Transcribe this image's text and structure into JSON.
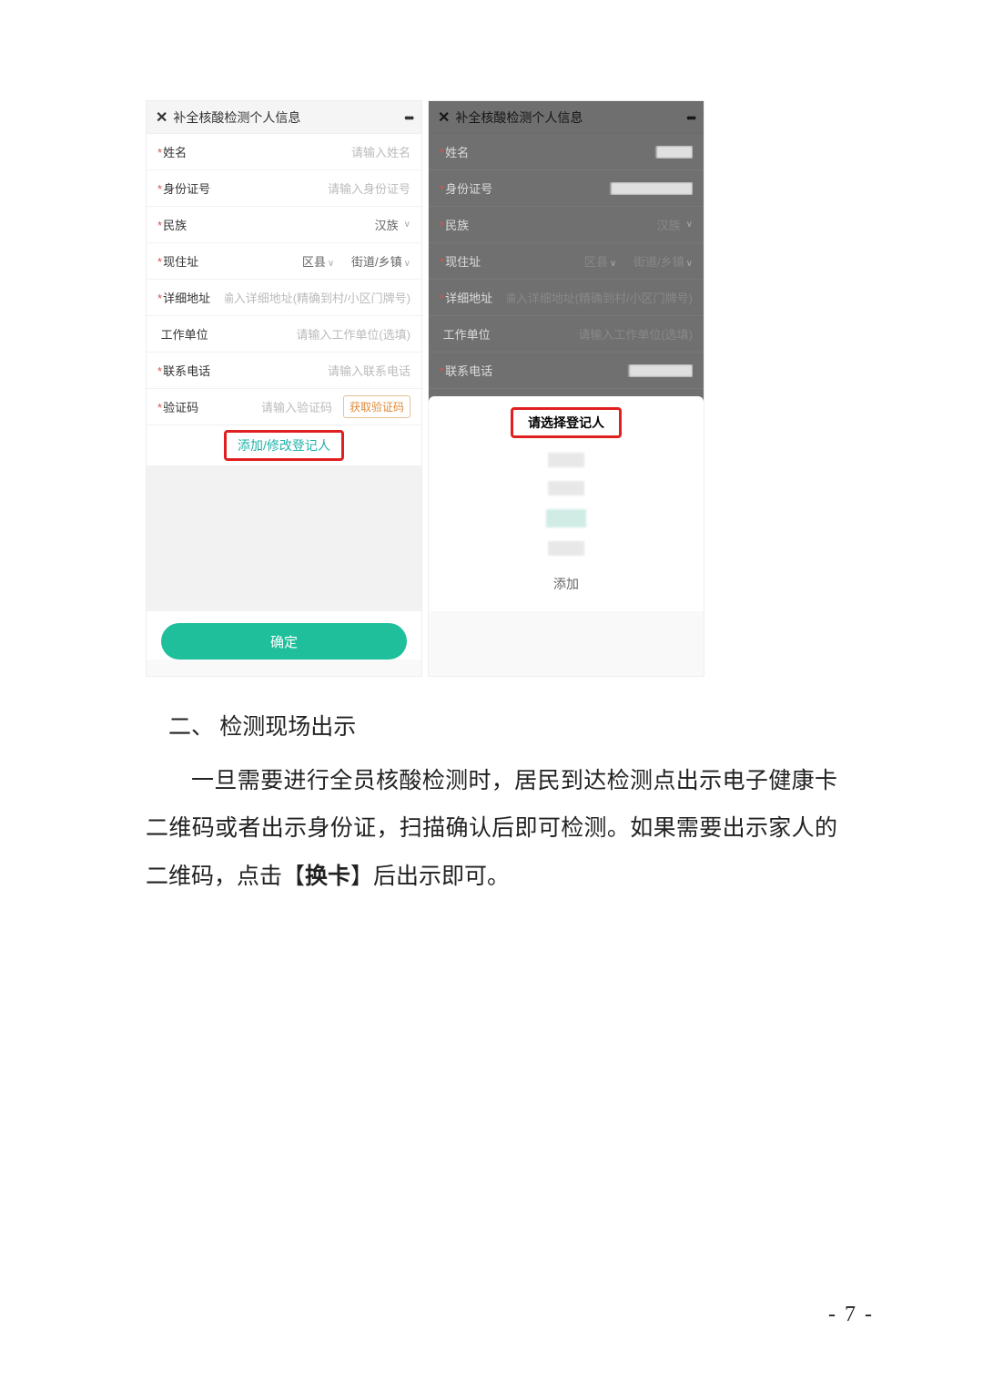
{
  "phone_header": {
    "close_glyph": "✕",
    "title": "补全核酸检测个人信息",
    "more_glyph": "•••"
  },
  "form": {
    "name_label": "姓名",
    "name_placeholder": "请输入姓名",
    "id_label": "身份证号",
    "id_placeholder": "请输入身份证号",
    "ethnicity_label": "民族",
    "ethnicity_value": "汉族",
    "address_label": "现住址",
    "district": "区县",
    "township": "街道/乡镇",
    "detail_label": "详细地址",
    "detail_placeholder": "请输入详细地址(精确到村/小区门牌号)",
    "work_label": "工作单位",
    "work_placeholder": "请输入工作单位(选填)",
    "phone_label": "联系电话",
    "phone_placeholder": "请输入联系电话",
    "captcha_label": "验证码",
    "captcha_placeholder": "请输入验证码",
    "get_code": "获取验证码",
    "add_modify": "添加/修改登记人",
    "confirm": "确定"
  },
  "sheet": {
    "title": "请选择登记人",
    "add": "添加"
  },
  "document": {
    "section_num": "二、",
    "section_title": "检测现场出示",
    "paragraph_1a": "一旦需要进行全员核酸检测时，居民到达检测点出示电子健康卡二维码或者出示身份证，扫描确认后即可检测。如果需要出示家人的二维码，点击【",
    "bold_word": "换卡",
    "paragraph_1b": "】后出示即可。",
    "page_number": "- 7 -"
  }
}
